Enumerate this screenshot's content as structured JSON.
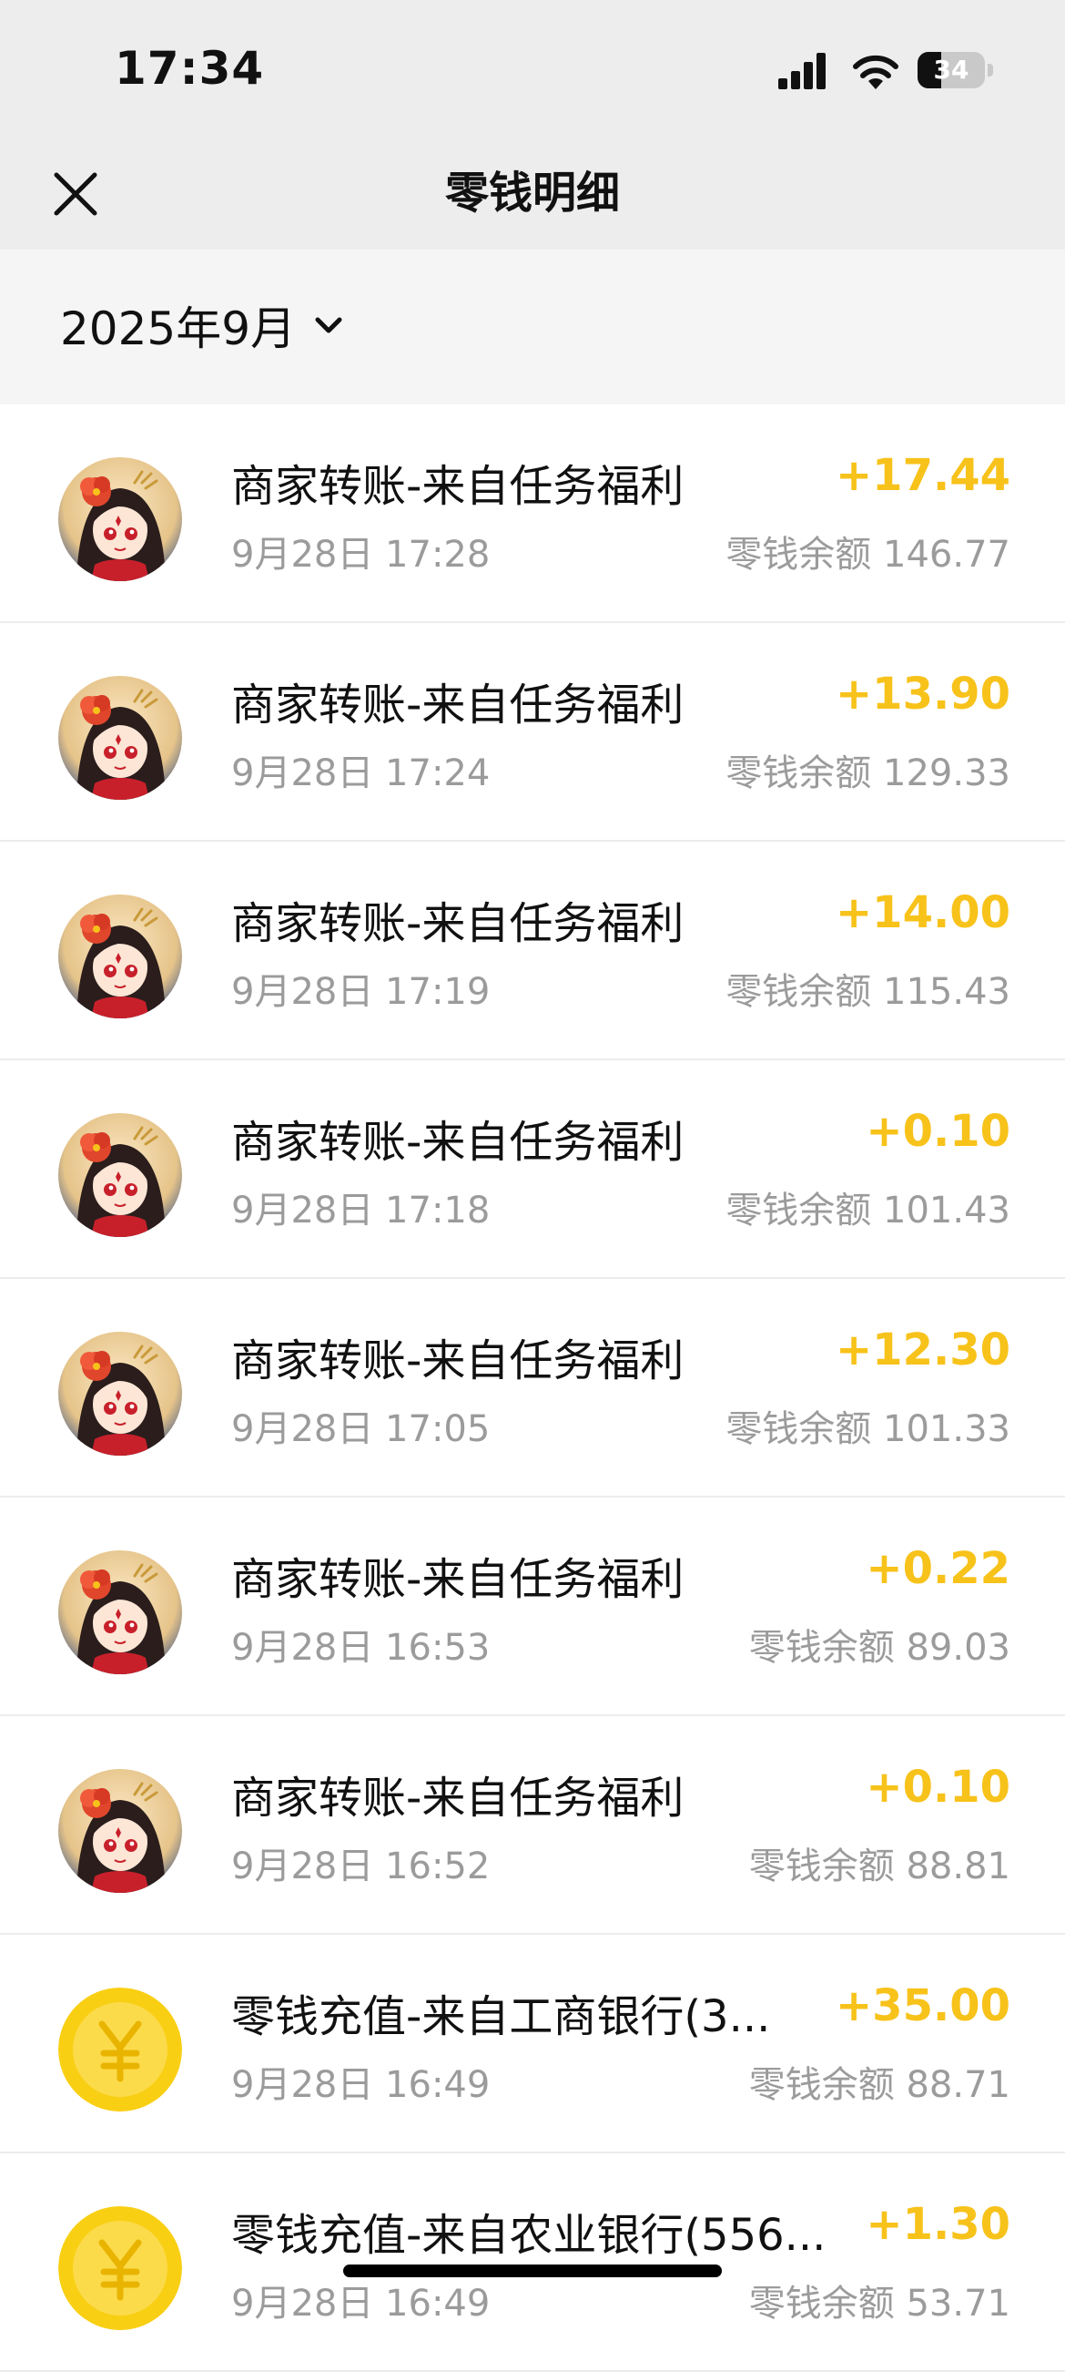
{
  "status_bar": {
    "time": "17:34",
    "battery": "34",
    "icons": [
      "signal-icon",
      "wifi-icon",
      "battery-icon"
    ]
  },
  "nav": {
    "title": "零钱明细",
    "close_icon": "close-icon"
  },
  "filter": {
    "month": "2025年9月",
    "icon": "chevron-down-icon"
  },
  "colors": {
    "income": "#f7c21a",
    "secondary_text": "#9b9b9b",
    "coin": "#f9cf14"
  },
  "transactions": [
    {
      "title": "商家转账-来自任务福利",
      "time": "9月28日 17:28",
      "amount": "+17.44",
      "balance": "零钱余额 146.77",
      "avatar": "character-avatar"
    },
    {
      "title": "商家转账-来自任务福利",
      "time": "9月28日 17:24",
      "amount": "+13.90",
      "balance": "零钱余额 129.33",
      "avatar": "character-avatar"
    },
    {
      "title": "商家转账-来自任务福利",
      "time": "9月28日 17:19",
      "amount": "+14.00",
      "balance": "零钱余额 115.43",
      "avatar": "character-avatar"
    },
    {
      "title": "商家转账-来自任务福利",
      "time": "9月28日 17:18",
      "amount": "+0.10",
      "balance": "零钱余额 101.43",
      "avatar": "character-avatar"
    },
    {
      "title": "商家转账-来自任务福利",
      "time": "9月28日 17:05",
      "amount": "+12.30",
      "balance": "零钱余额 101.33",
      "avatar": "character-avatar"
    },
    {
      "title": "商家转账-来自任务福利",
      "time": "9月28日 16:53",
      "amount": "+0.22",
      "balance": "零钱余额 89.03",
      "avatar": "character-avatar"
    },
    {
      "title": "商家转账-来自任务福利",
      "time": "9月28日 16:52",
      "amount": "+0.10",
      "balance": "零钱余额 88.81",
      "avatar": "character-avatar"
    },
    {
      "title": "零钱充值-来自工商银行(3...",
      "time": "9月28日 16:49",
      "amount": "+35.00",
      "balance": "零钱余额 88.71",
      "avatar": "yuan-coin-icon"
    },
    {
      "title": "零钱充值-来自农业银行(556...",
      "time": "9月28日 16:49",
      "amount": "+1.30",
      "balance": "零钱余额 53.71",
      "avatar": "yuan-coin-icon"
    }
  ]
}
